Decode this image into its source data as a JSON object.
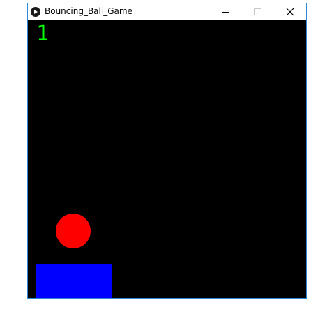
{
  "window": {
    "title": "Bouncing_Ball_Game",
    "app_icon": "play-icon",
    "controls": {
      "minimize_icon": "minimize-icon",
      "maximize_icon": "maximize-icon",
      "close_icon": "close-icon",
      "close_glyph": "✕"
    }
  },
  "game": {
    "score": "1",
    "colors": {
      "background": "#000000",
      "score": "#00ff00",
      "ball": "#ff0000",
      "paddle": "#0000ff"
    }
  }
}
